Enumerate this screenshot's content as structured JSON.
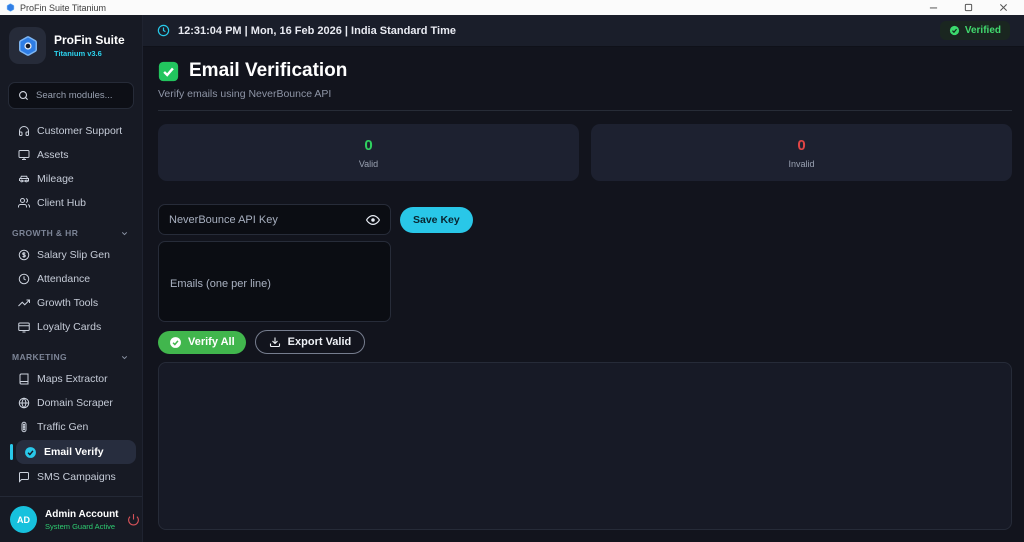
{
  "window": {
    "title": "ProFin Suite Titanium"
  },
  "topbar": {
    "datetime": "12:31:04 PM | Mon, 16 Feb 2026 | India Standard Time",
    "verified_label": "Verified"
  },
  "sidebar": {
    "brand": {
      "name": "ProFin Suite",
      "version": "Titanium v3.6"
    },
    "search": {
      "placeholder": "Search modules..."
    },
    "main_items": [
      {
        "icon": "headset-icon",
        "label": "Customer Support"
      },
      {
        "icon": "monitor-icon",
        "label": "Assets"
      },
      {
        "icon": "car-icon",
        "label": "Mileage"
      },
      {
        "icon": "users-icon",
        "label": "Client Hub"
      }
    ],
    "sections": [
      {
        "label": "GROWTH & HR",
        "items": [
          {
            "icon": "dollar-circle-icon",
            "label": "Salary Slip Gen"
          },
          {
            "icon": "clock-icon",
            "label": "Attendance"
          },
          {
            "icon": "trending-up-icon",
            "label": "Growth Tools"
          },
          {
            "icon": "credit-card-icon",
            "label": "Loyalty Cards"
          }
        ]
      },
      {
        "label": "MARKETING",
        "items": [
          {
            "icon": "book-icon",
            "label": "Maps Extractor"
          },
          {
            "icon": "globe-icon",
            "label": "Domain Scraper"
          },
          {
            "icon": "traffic-light-icon",
            "label": "Traffic Gen"
          },
          {
            "icon": "check-badge-icon",
            "label": "Email Verify",
            "active": true
          },
          {
            "icon": "message-icon",
            "label": "SMS Campaigns"
          }
        ]
      }
    ],
    "user": {
      "initials": "AD",
      "name": "Admin Account",
      "status": "System Guard Active"
    }
  },
  "main": {
    "heading": "Email Verification",
    "subtitle": "Verify emails using NeverBounce API",
    "stats": [
      {
        "value": "0",
        "label": "Valid"
      },
      {
        "value": "0",
        "label": "Invalid"
      }
    ],
    "api_key": {
      "placeholder": "NeverBounce API Key",
      "value": ""
    },
    "save_key_label": "Save Key",
    "emails": {
      "placeholder": "Emails (one per line)",
      "value": ""
    },
    "verify_all_label": "Verify All",
    "export_valid_label": "Export Valid"
  },
  "colors": {
    "accent_cyan": "#29c8ea",
    "valid_green": "#2fd05f",
    "invalid_red": "#e04545",
    "verify_button_green": "#41b64d",
    "heading_check_green": "#22c55e",
    "verified_badge_green": "#41d96e",
    "status_green": "#2ecc71",
    "power_red": "#d8535a"
  }
}
